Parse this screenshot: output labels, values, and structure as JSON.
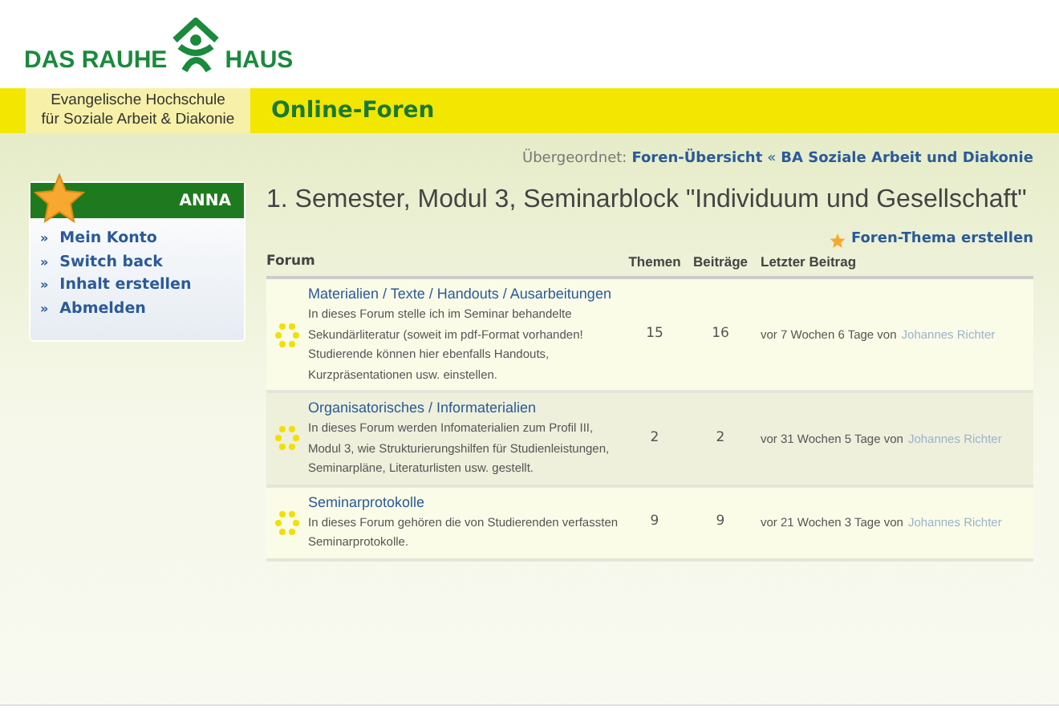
{
  "logo": {
    "left": "DAS RAUHE",
    "right": "HAUS"
  },
  "header": {
    "school_lines": [
      "Evangelische Hochschule",
      "für Soziale Arbeit & Diakonie"
    ],
    "section_title": "Online-Foren"
  },
  "user_box": {
    "name": "ANNA",
    "links": [
      "Mein Konto",
      "Switch back",
      "Inhalt erstellen",
      "Abmelden"
    ],
    "bullet": "»"
  },
  "breadcrumb": {
    "label": "Übergeordnet:",
    "links": [
      "Foren-Übersicht",
      "BA Soziale Arbeit und Diakonie"
    ],
    "separator": "«"
  },
  "page_title": "1. Semester, Modul 3, Seminarblock \"Individuum und Gesellschaft\"",
  "create_link": "Foren-Thema erstellen",
  "table": {
    "columns": [
      "Forum",
      "Themen",
      "Beiträge",
      "Letzter Beitrag"
    ],
    "rows": [
      {
        "title": "Materialien / Texte / Handouts / Ausarbeitungen",
        "description": "In dieses Forum stelle ich im Seminar behandelte Sekundärliteratur (soweit im pdf-Format vorhanden! Studierende können hier ebenfalls Handouts, Kurzpräsentationen usw. einstellen.",
        "topics": "15",
        "posts": "16",
        "last_post": "vor 7 Wochen 6 Tage von",
        "author": "Johannes Richter"
      },
      {
        "title": "Organisatorisches / Informaterialien",
        "description": "In dieses Forum werden Infomaterialien zum Profil III, Modul 3, wie Strukturierungshilfen für Studienleistungen, Seminarpläne, Literaturlisten usw. gestellt.",
        "topics": "2",
        "posts": "2",
        "last_post": "vor 31 Wochen 5 Tage von",
        "author": "Johannes Richter"
      },
      {
        "title": "Seminarprotokolle",
        "description": "In dieses Forum gehören die von Studierenden verfassten Seminarprotokolle.",
        "topics": "9",
        "posts": "9",
        "last_post": "vor 21 Wochen 3 Tage von",
        "author": "Johannes Richter"
      }
    ]
  }
}
